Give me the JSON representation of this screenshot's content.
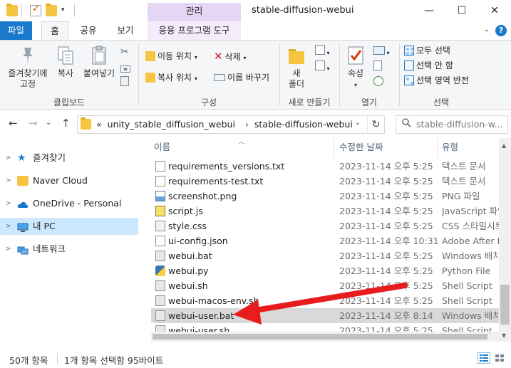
{
  "window": {
    "context_tab_header": "관리",
    "title": "stable-diffusion-webui",
    "minimize": "—",
    "maximize": "☐",
    "close": "✕"
  },
  "ribbon_tabs": {
    "file": "파일",
    "home": "홈",
    "share": "공유",
    "view": "보기",
    "app_tools": "응용 프로그램 도구",
    "help": "?"
  },
  "ribbon": {
    "clipboard": {
      "pin": "즐겨찾기에 고정",
      "copy": "복사",
      "paste": "붙여넣기",
      "label": "클립보드"
    },
    "organize": {
      "move_to": "이동 위치",
      "copy_to": "복사 위치",
      "delete": "삭제",
      "rename": "이름 바꾸기",
      "label": "구성"
    },
    "new": {
      "new_folder": "새 폴더",
      "label": "새로 만들기"
    },
    "open": {
      "properties": "속성",
      "label": "열기"
    },
    "select": {
      "select_all": "모두 선택",
      "select_none": "선택 안 함",
      "invert": "선택 영역 반전",
      "label": "선택"
    }
  },
  "address": {
    "overflow": "«",
    "crumb1": "unity_stable_diffusion_webui",
    "sep": "›",
    "crumb2": "stable-diffusion-webui",
    "dropdown": "⌄",
    "refresh": "↻"
  },
  "search": {
    "placeholder": "stable-diffusion-w..."
  },
  "nav": {
    "back": "←",
    "forward": "→",
    "recent": "⌄",
    "up": "↑",
    "items": [
      {
        "label": "즐겨찾기",
        "icon": "star-icon"
      },
      {
        "label": "Naver Cloud",
        "icon": "cloud-folder-icon"
      },
      {
        "label": "OneDrive - Personal",
        "icon": "onedrive-icon"
      },
      {
        "label": "내 PC",
        "icon": "pc-icon"
      },
      {
        "label": "네트워크",
        "icon": "network-icon"
      }
    ]
  },
  "columns": {
    "name": "이름",
    "date": "수정한 날짜",
    "type": "유형"
  },
  "files": [
    {
      "name": "requirements_versions.txt",
      "date": "2023-11-14 오후 5:25",
      "type": "텍스트 문서",
      "icon": "txt-file-icon"
    },
    {
      "name": "requirements-test.txt",
      "date": "2023-11-14 오후 5:25",
      "type": "텍스트 문서",
      "icon": "txt-file-icon"
    },
    {
      "name": "screenshot.png",
      "date": "2023-11-14 오후 5:25",
      "type": "PNG 파일",
      "icon": "png-file-icon"
    },
    {
      "name": "script.js",
      "date": "2023-11-14 오후 5:25",
      "type": "JavaScript 파일",
      "icon": "js-file-icon"
    },
    {
      "name": "style.css",
      "date": "2023-11-14 오후 5:25",
      "type": "CSS 스타일시트",
      "icon": "css-file-icon"
    },
    {
      "name": "ui-config.json",
      "date": "2023-11-14 오후 10:31",
      "type": "Adobe After Ef",
      "icon": "json-file-icon"
    },
    {
      "name": "webui.bat",
      "date": "2023-11-14 오후 5:25",
      "type": "Windows 배치",
      "icon": "bat-file-icon"
    },
    {
      "name": "webui.py",
      "date": "2023-11-14 오후 5:25",
      "type": "Python File",
      "icon": "py-file-icon"
    },
    {
      "name": "webui.sh",
      "date": "2023-11-14 오후 5:25",
      "type": "Shell Script",
      "icon": "sh-file-icon"
    },
    {
      "name": "webui-macos-env.sh",
      "date": "2023-11-14 오후 5:25",
      "type": "Shell Script",
      "icon": "sh-file-icon"
    },
    {
      "name": "webui-user.bat",
      "date": "2023-11-14 오후 8:14",
      "type": "Windows 배치",
      "icon": "bat-file-icon"
    },
    {
      "name": "webui-user.sh",
      "date": "2023-11-14 오후 5:25",
      "type": "Shell Script",
      "icon": "sh-file-icon"
    }
  ],
  "status": {
    "count": "50개 항목",
    "selection": "1개 항목 선택함 95바이트"
  },
  "colors": {
    "accent": "#1979ca",
    "context_tab": "#e6d6f5",
    "selection": "#cce8ff",
    "arrow": "#e81c1c"
  }
}
